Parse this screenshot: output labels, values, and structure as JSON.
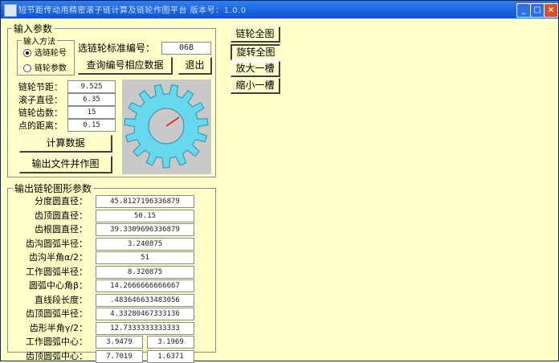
{
  "window": {
    "title": "短节距传动用精密滚子链计算及链轮作图平台     版本号：1.0.0",
    "minimize": "_",
    "maximize": "□",
    "close": "×"
  },
  "input": {
    "group_label": "输入参数",
    "method_label": "输入方法",
    "options": [
      "选链轮号",
      "链轮参数"
    ],
    "selected_option": "选链轮号",
    "sprocket_label": "选链轮标准编号：",
    "sprocket_value": "06B",
    "query_button": "查询编号相应数据",
    "exit_button": "退出",
    "fields": [
      {
        "label": "链轮节距：",
        "value": "9.525"
      },
      {
        "label": "滚子直径：",
        "value": "6.35"
      },
      {
        "label": "链轮齿数：",
        "value": "15"
      },
      {
        "label": "点的距离：",
        "value": "0.15"
      }
    ],
    "calc_button": "计算数据",
    "output_button": "输出文件并作图"
  },
  "gear": {
    "teeth": 15,
    "fill_color": "#66d9ee",
    "hole_color": "#c9c9c9",
    "background": "#c9c9c9",
    "line_color": "#ff0000"
  },
  "right_buttons": [
    "链轮全图",
    "旋转全图",
    "放大一槽",
    "缩小一槽"
  ],
  "output": {
    "group_label": "输出链轮图形参数",
    "rows": [
      {
        "label": "分度圆直径：",
        "value": "45.8127196336879"
      },
      {
        "label": "齿顶圆直径：",
        "value": "50.15"
      },
      {
        "label": "齿根圆直径：",
        "value": "39.3309696336879"
      },
      {
        "label": "齿沟圆弧半径：",
        "value": "3.240875"
      },
      {
        "label": "齿沟半角α/2：",
        "value": "51"
      },
      {
        "label": "工作圆弧半径：",
        "value": "8.320875"
      },
      {
        "label": "圆弧中心角β：",
        "value": "14.2666666666667"
      },
      {
        "label": "直线段长度：",
        "value": ".483646633483056"
      },
      {
        "label": "齿顶圆弧半径：",
        "value": "4.33280467333136"
      },
      {
        "label": "齿形半角γ/2：",
        "value": "12.7333333333333"
      },
      {
        "label": "工作圆弧中心：",
        "values": [
          "3.9479",
          "3.1969"
        ]
      },
      {
        "label": "齿顶圆弧中心：",
        "values": [
          "7.7019",
          "1.6371"
        ]
      }
    ]
  }
}
